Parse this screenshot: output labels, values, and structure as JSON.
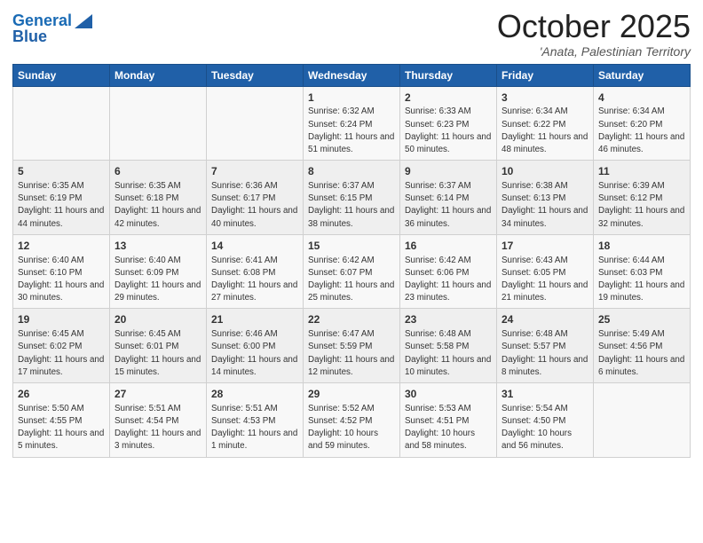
{
  "header": {
    "logo_line1": "General",
    "logo_line2": "Blue",
    "month": "October 2025",
    "location": "'Anata, Palestinian Territory"
  },
  "weekdays": [
    "Sunday",
    "Monday",
    "Tuesday",
    "Wednesday",
    "Thursday",
    "Friday",
    "Saturday"
  ],
  "rows": [
    [
      {
        "day": "",
        "info": ""
      },
      {
        "day": "",
        "info": ""
      },
      {
        "day": "",
        "info": ""
      },
      {
        "day": "1",
        "info": "Sunrise: 6:32 AM\nSunset: 6:24 PM\nDaylight: 11 hours and 51 minutes."
      },
      {
        "day": "2",
        "info": "Sunrise: 6:33 AM\nSunset: 6:23 PM\nDaylight: 11 hours and 50 minutes."
      },
      {
        "day": "3",
        "info": "Sunrise: 6:34 AM\nSunset: 6:22 PM\nDaylight: 11 hours and 48 minutes."
      },
      {
        "day": "4",
        "info": "Sunrise: 6:34 AM\nSunset: 6:20 PM\nDaylight: 11 hours and 46 minutes."
      }
    ],
    [
      {
        "day": "5",
        "info": "Sunrise: 6:35 AM\nSunset: 6:19 PM\nDaylight: 11 hours and 44 minutes."
      },
      {
        "day": "6",
        "info": "Sunrise: 6:35 AM\nSunset: 6:18 PM\nDaylight: 11 hours and 42 minutes."
      },
      {
        "day": "7",
        "info": "Sunrise: 6:36 AM\nSunset: 6:17 PM\nDaylight: 11 hours and 40 minutes."
      },
      {
        "day": "8",
        "info": "Sunrise: 6:37 AM\nSunset: 6:15 PM\nDaylight: 11 hours and 38 minutes."
      },
      {
        "day": "9",
        "info": "Sunrise: 6:37 AM\nSunset: 6:14 PM\nDaylight: 11 hours and 36 minutes."
      },
      {
        "day": "10",
        "info": "Sunrise: 6:38 AM\nSunset: 6:13 PM\nDaylight: 11 hours and 34 minutes."
      },
      {
        "day": "11",
        "info": "Sunrise: 6:39 AM\nSunset: 6:12 PM\nDaylight: 11 hours and 32 minutes."
      }
    ],
    [
      {
        "day": "12",
        "info": "Sunrise: 6:40 AM\nSunset: 6:10 PM\nDaylight: 11 hours and 30 minutes."
      },
      {
        "day": "13",
        "info": "Sunrise: 6:40 AM\nSunset: 6:09 PM\nDaylight: 11 hours and 29 minutes."
      },
      {
        "day": "14",
        "info": "Sunrise: 6:41 AM\nSunset: 6:08 PM\nDaylight: 11 hours and 27 minutes."
      },
      {
        "day": "15",
        "info": "Sunrise: 6:42 AM\nSunset: 6:07 PM\nDaylight: 11 hours and 25 minutes."
      },
      {
        "day": "16",
        "info": "Sunrise: 6:42 AM\nSunset: 6:06 PM\nDaylight: 11 hours and 23 minutes."
      },
      {
        "day": "17",
        "info": "Sunrise: 6:43 AM\nSunset: 6:05 PM\nDaylight: 11 hours and 21 minutes."
      },
      {
        "day": "18",
        "info": "Sunrise: 6:44 AM\nSunset: 6:03 PM\nDaylight: 11 hours and 19 minutes."
      }
    ],
    [
      {
        "day": "19",
        "info": "Sunrise: 6:45 AM\nSunset: 6:02 PM\nDaylight: 11 hours and 17 minutes."
      },
      {
        "day": "20",
        "info": "Sunrise: 6:45 AM\nSunset: 6:01 PM\nDaylight: 11 hours and 15 minutes."
      },
      {
        "day": "21",
        "info": "Sunrise: 6:46 AM\nSunset: 6:00 PM\nDaylight: 11 hours and 14 minutes."
      },
      {
        "day": "22",
        "info": "Sunrise: 6:47 AM\nSunset: 5:59 PM\nDaylight: 11 hours and 12 minutes."
      },
      {
        "day": "23",
        "info": "Sunrise: 6:48 AM\nSunset: 5:58 PM\nDaylight: 11 hours and 10 minutes."
      },
      {
        "day": "24",
        "info": "Sunrise: 6:48 AM\nSunset: 5:57 PM\nDaylight: 11 hours and 8 minutes."
      },
      {
        "day": "25",
        "info": "Sunrise: 5:49 AM\nSunset: 4:56 PM\nDaylight: 11 hours and 6 minutes."
      }
    ],
    [
      {
        "day": "26",
        "info": "Sunrise: 5:50 AM\nSunset: 4:55 PM\nDaylight: 11 hours and 5 minutes."
      },
      {
        "day": "27",
        "info": "Sunrise: 5:51 AM\nSunset: 4:54 PM\nDaylight: 11 hours and 3 minutes."
      },
      {
        "day": "28",
        "info": "Sunrise: 5:51 AM\nSunset: 4:53 PM\nDaylight: 11 hours and 1 minute."
      },
      {
        "day": "29",
        "info": "Sunrise: 5:52 AM\nSunset: 4:52 PM\nDaylight: 10 hours and 59 minutes."
      },
      {
        "day": "30",
        "info": "Sunrise: 5:53 AM\nSunset: 4:51 PM\nDaylight: 10 hours and 58 minutes."
      },
      {
        "day": "31",
        "info": "Sunrise: 5:54 AM\nSunset: 4:50 PM\nDaylight: 10 hours and 56 minutes."
      },
      {
        "day": "",
        "info": ""
      }
    ]
  ]
}
